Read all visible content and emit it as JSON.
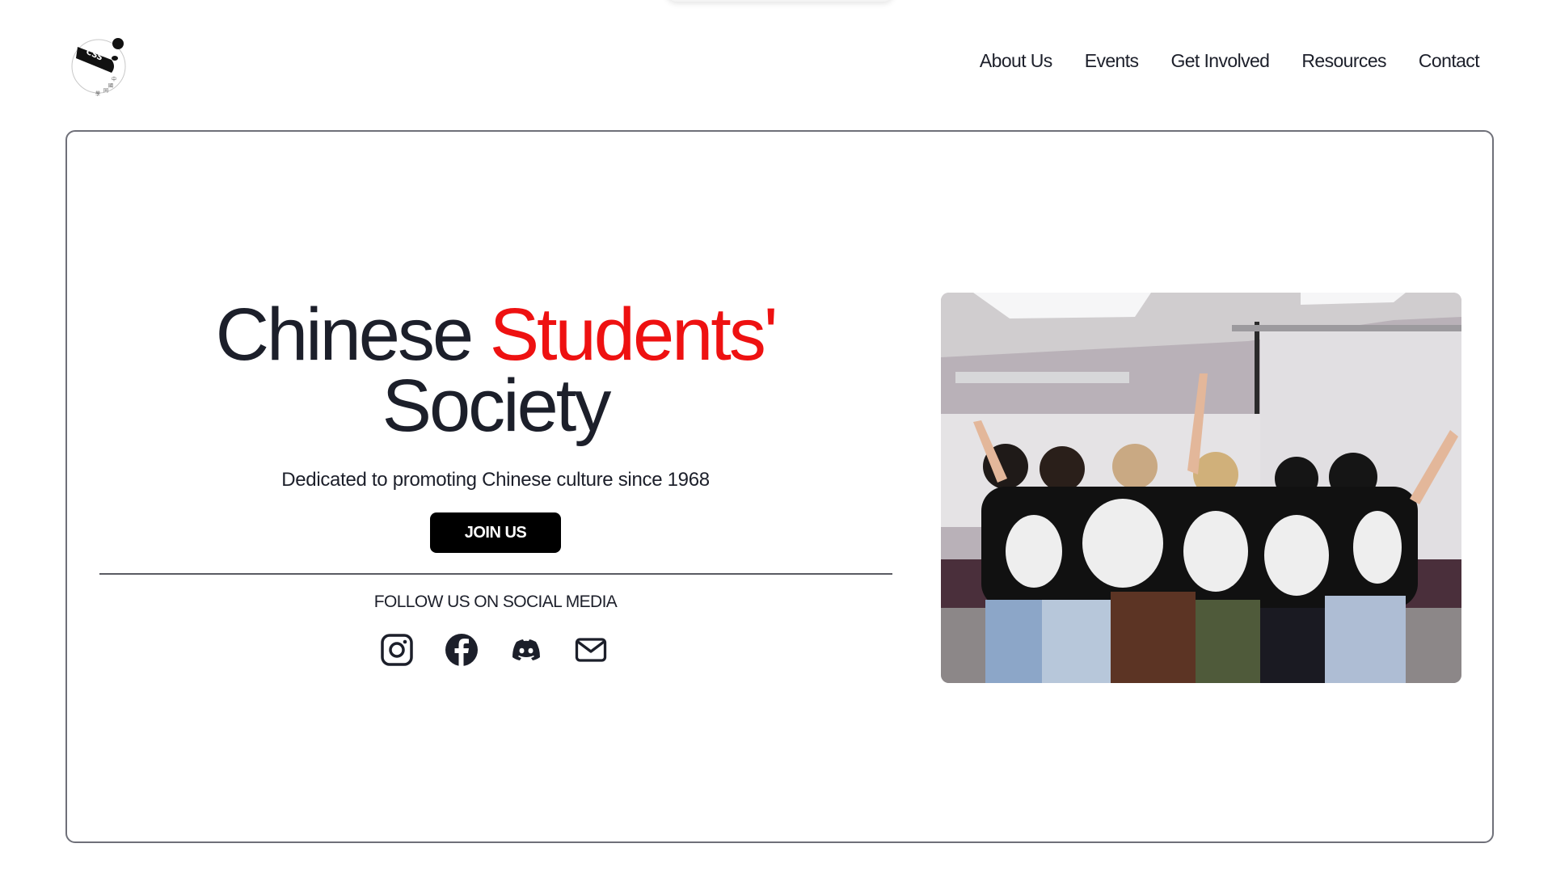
{
  "header": {
    "logo": {
      "text": "CSS",
      "icon": "panda-logo-icon"
    },
    "nav": [
      {
        "label": "About Us"
      },
      {
        "label": "Events"
      },
      {
        "label": "Get Involved"
      },
      {
        "label": "Resources"
      },
      {
        "label": "Contact"
      }
    ]
  },
  "hero": {
    "title_part1": "Chinese",
    "title_accent": "Students'",
    "title_part2": "Society",
    "subtitle": "Dedicated to promoting Chinese culture since 1968",
    "cta_label": "JOIN US",
    "follow_label": "FOLLOW US ON SOCIAL MEDIA",
    "socials": [
      {
        "name": "instagram",
        "icon": "instagram-icon"
      },
      {
        "name": "facebook",
        "icon": "facebook-icon"
      },
      {
        "name": "discord",
        "icon": "discord-icon"
      },
      {
        "name": "email",
        "icon": "mail-icon"
      }
    ],
    "photo_alt": "Group of members in panda t-shirts with arms around each other"
  },
  "colors": {
    "text": "#1c1f2a",
    "accent": "#ee1111",
    "button": "#000000",
    "border": "#6f7079"
  }
}
